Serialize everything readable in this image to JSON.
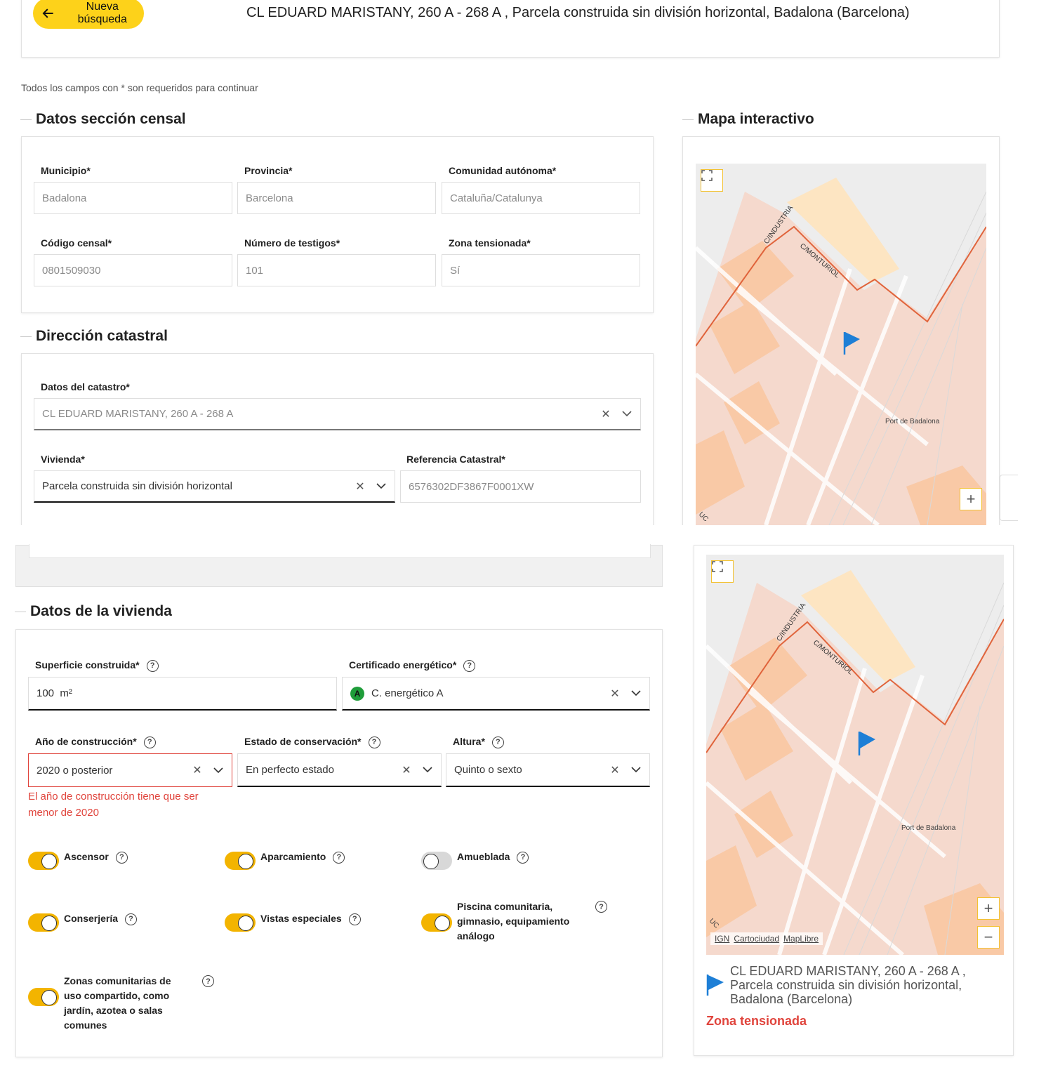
{
  "header": {
    "back_label": "Nueva búsqueda",
    "address": "CL EDUARD MARISTANY, 260 A - 268 A , Parcela construida sin división horizontal, Badalona (Barcelona)"
  },
  "required_note": "Todos los campos con * son requeridos para continuar",
  "census": {
    "title": "Datos sección censal",
    "municipio": {
      "label": "Municipio*",
      "value": "Badalona"
    },
    "provincia": {
      "label": "Provincia*",
      "value": "Barcelona"
    },
    "comunidad": {
      "label": "Comunidad autónoma*",
      "value": "Cataluña/Catalunya"
    },
    "codigo": {
      "label": "Código censal*",
      "value": "0801509030"
    },
    "testigos": {
      "label": "Número de testigos*",
      "value": "101"
    },
    "zona": {
      "label": "Zona tensionada*",
      "value": "Sí"
    }
  },
  "catastro": {
    "title": "Dirección catastral",
    "datos": {
      "label": "Datos del catastro*",
      "value": "CL EDUARD MARISTANY, 260 A - 268 A"
    },
    "vivienda": {
      "label": "Vivienda*",
      "value": "Parcela construida sin división horizontal"
    },
    "referencia": {
      "label": "Referencia Catastral*",
      "value": "6576302DF3867F0001XW"
    }
  },
  "map": {
    "title": "Mapa interactivo",
    "streets": [
      "C/INDUSTRIA",
      "C/MONTURIOL"
    ],
    "place_label": "Port de Badalona",
    "corner_label": "UC",
    "zoom_in": "+",
    "zoom_out": "−",
    "attribution": [
      "IGN",
      "Cartociudad",
      "MapLibre"
    ],
    "address": "CL EDUARD MARISTANY, 260 A - 268 A , Parcela construida sin división horizontal, Badalona (Barcelona)",
    "status": "Zona tensionada",
    "colors": {
      "zone": "#f5d9cd",
      "building": "#f9c9a6",
      "border": "#e0643c",
      "flag": "#1e7fd6",
      "status": "#e0443c"
    }
  },
  "vivienda": {
    "title": "Datos de la vivienda",
    "superficie": {
      "label": "Superficie construida*",
      "value": "100",
      "unit": "m²"
    },
    "certificado": {
      "label": "Certificado energético*",
      "badge": "A",
      "value": "C. energético A"
    },
    "anio": {
      "label": "Año de construcción*",
      "value": "2020 o posterior",
      "error": "El año de construcción tiene que ser menor de 2020"
    },
    "estado": {
      "label": "Estado de conservación*",
      "value": "En perfecto estado"
    },
    "altura": {
      "label": "Altura*",
      "value": "Quinto o sexto"
    },
    "toggles": [
      {
        "label": "Ascensor",
        "on": true
      },
      {
        "label": "Aparcamiento",
        "on": true
      },
      {
        "label": "Amueblada",
        "on": false
      },
      {
        "label": "Conserjería",
        "on": true
      },
      {
        "label": "Vistas especiales",
        "on": true
      },
      {
        "label": "Piscina comunitaria, gimnasio, equipamiento análogo",
        "on": true
      },
      {
        "label": "Zonas comunitarias de uso compartido, como jardín, azotea o salas comunes",
        "on": true
      }
    ]
  }
}
